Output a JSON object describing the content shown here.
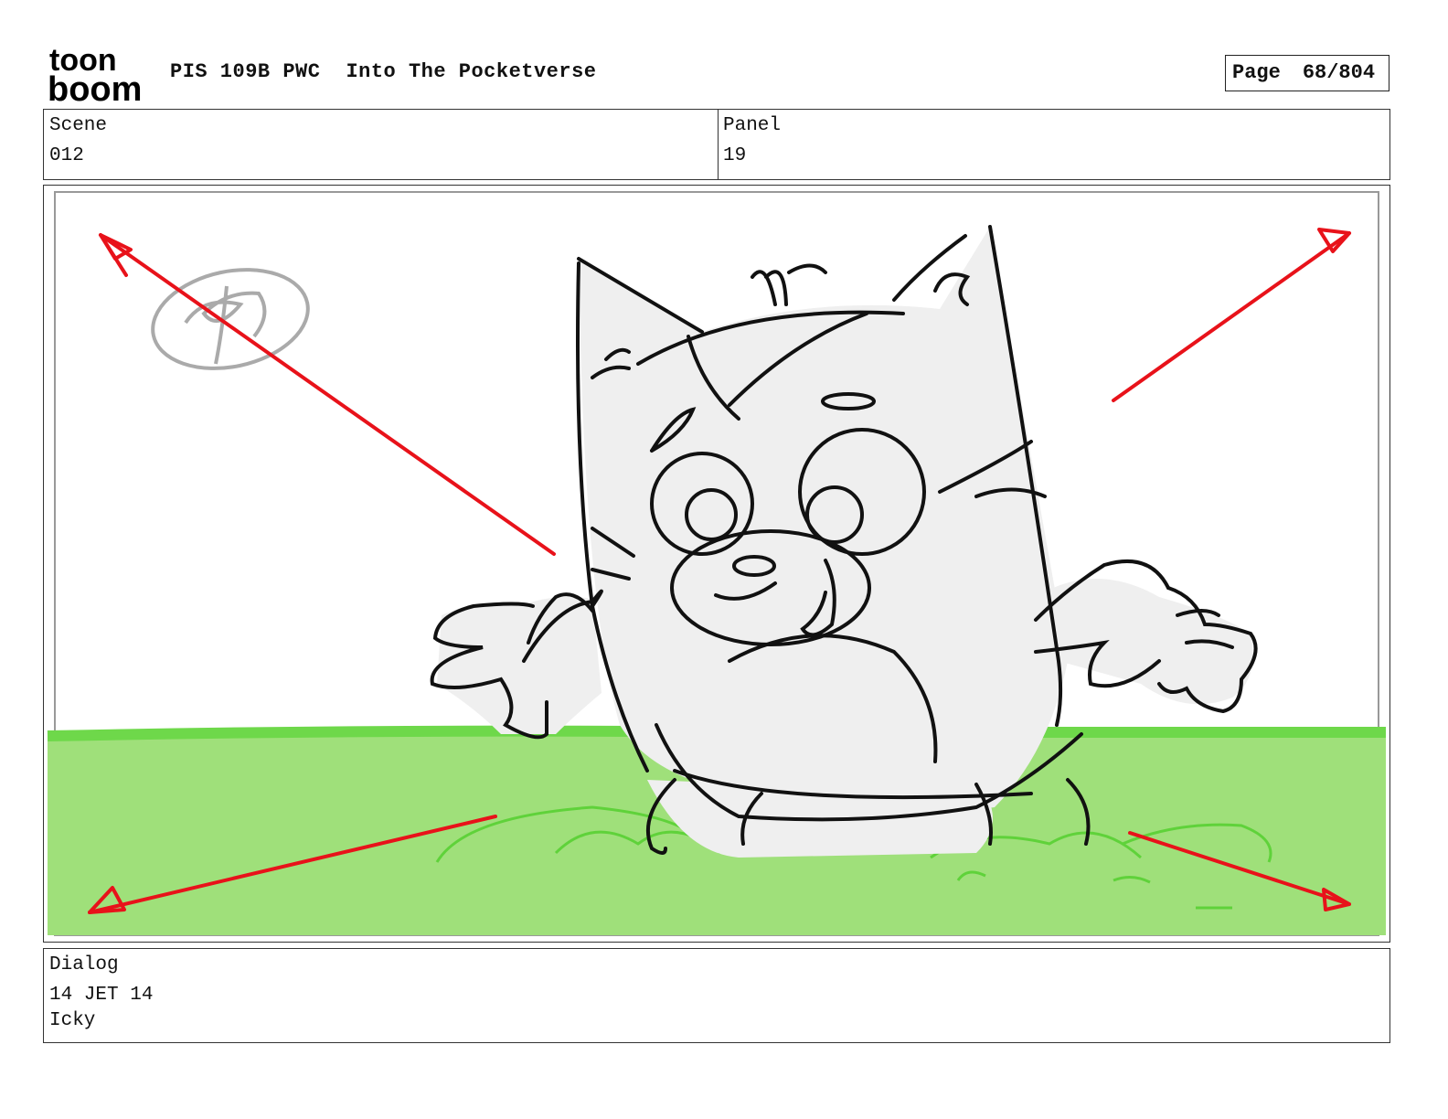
{
  "header": {
    "logo_top": "toon",
    "logo_bottom": "boom",
    "production": "PIS 109B PWC",
    "episode_title": "Into The Pocketverse",
    "page_label": "Page",
    "page_number": "68/804"
  },
  "scene": {
    "label": "Scene",
    "value": "012"
  },
  "panel": {
    "label": "Panel",
    "value": "19"
  },
  "dialog": {
    "label": "Dialog",
    "speaker": "14 JET 14",
    "line": "Icky"
  },
  "colors": {
    "arrow": "#e8121a",
    "grass": "#9fe07a",
    "grass_edge": "#6ed84a",
    "character_fill": "#efefef",
    "sketch_line": "#111111"
  }
}
